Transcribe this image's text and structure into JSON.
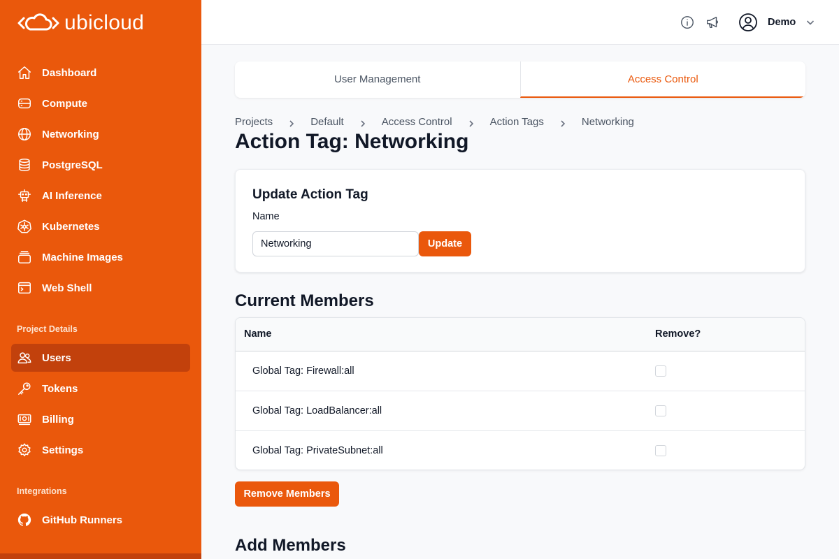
{
  "app": {
    "logo_text": "ubicloud"
  },
  "sidebar": {
    "main_items": [
      {
        "label": "Dashboard",
        "icon": "home-icon"
      },
      {
        "label": "Compute",
        "icon": "server-icon"
      },
      {
        "label": "Networking",
        "icon": "globe-icon"
      },
      {
        "label": "PostgreSQL",
        "icon": "database-icon"
      },
      {
        "label": "AI Inference",
        "icon": "robot-icon"
      },
      {
        "label": "Kubernetes",
        "icon": "helm-icon"
      },
      {
        "label": "Machine Images",
        "icon": "layers-icon"
      },
      {
        "label": "Web Shell",
        "icon": "terminal-icon"
      }
    ],
    "project_section_label": "Project Details",
    "project_items": [
      {
        "label": "Users",
        "icon": "users-icon",
        "active": true
      },
      {
        "label": "Tokens",
        "icon": "key-icon"
      },
      {
        "label": "Billing",
        "icon": "banknote-icon"
      },
      {
        "label": "Settings",
        "icon": "gear-icon"
      }
    ],
    "integrations_section_label": "Integrations",
    "integration_items": [
      {
        "label": "GitHub Runners",
        "icon": "github-icon"
      }
    ]
  },
  "header": {
    "user_name": "Demo",
    "icons": [
      "info-icon",
      "megaphone-icon",
      "user-circle-icon",
      "chevron-down-icon"
    ]
  },
  "tabs": [
    {
      "label": "User Management",
      "active": false
    },
    {
      "label": "Access Control",
      "active": true
    }
  ],
  "breadcrumb": [
    "Projects",
    "Default",
    "Access Control",
    "Action Tags",
    "Networking"
  ],
  "page_title": "Action Tag: Networking",
  "update_card": {
    "title": "Update Action Tag",
    "name_label": "Name",
    "name_value": "Networking",
    "button_label": "Update"
  },
  "current_members": {
    "title": "Current Members",
    "col_name": "Name",
    "col_remove": "Remove?",
    "rows": [
      {
        "name": "Global Tag: Firewall:all",
        "checked": false
      },
      {
        "name": "Global Tag: LoadBalancer:all",
        "checked": false
      },
      {
        "name": "Global Tag: PrivateSubnet:all",
        "checked": false
      }
    ],
    "button_label": "Remove Members"
  },
  "add_members": {
    "title": "Add Members"
  },
  "colors": {
    "brand": "#ea580c",
    "brand_dark": "#c2410c"
  }
}
